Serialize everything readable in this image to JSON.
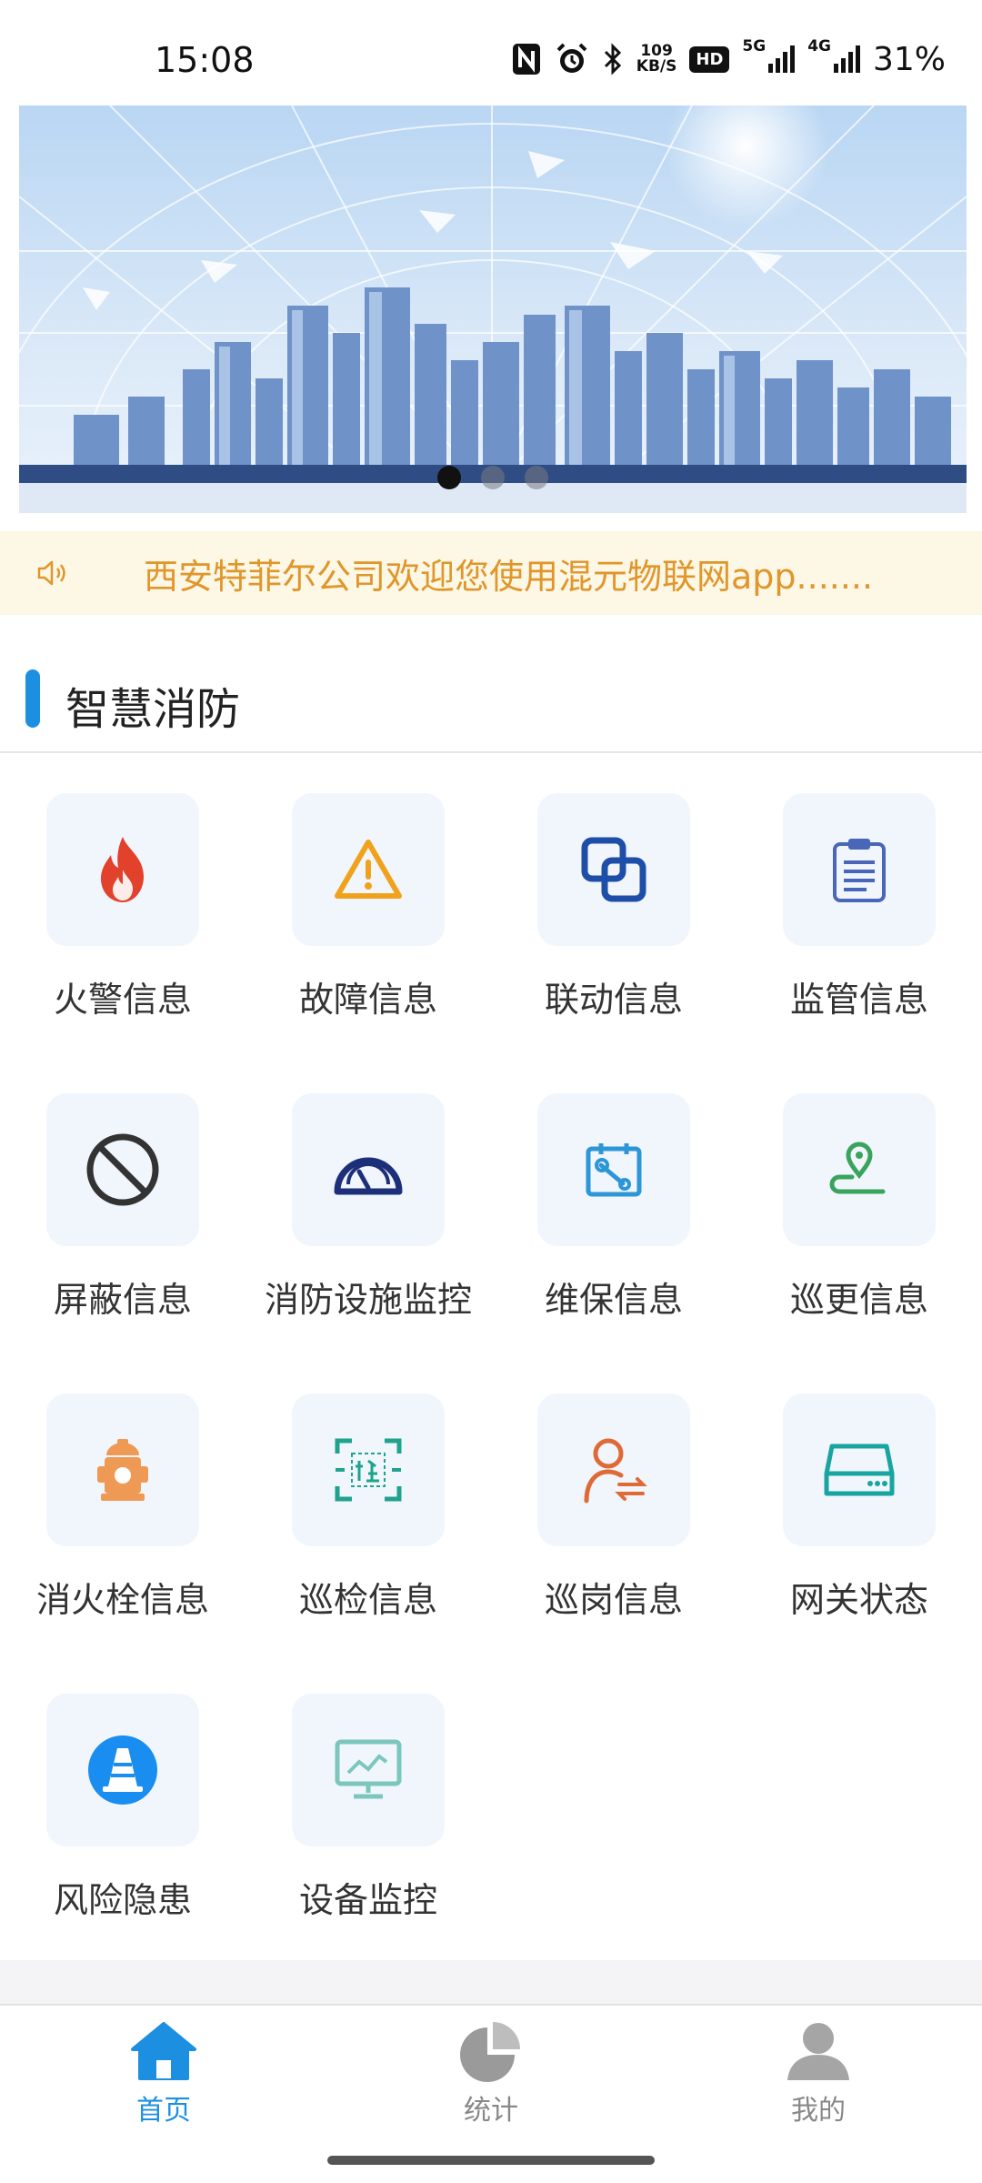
{
  "status_bar": {
    "time": "15:08",
    "icons": [
      "nfc-icon",
      "alarm-icon",
      "bluetooth-icon",
      "network-speed-icon",
      "hd-icon",
      "signal-5g-icon",
      "signal-4g-icon"
    ],
    "net_speed_value": "109",
    "net_speed_unit": "KB/S",
    "hd_label": "HD",
    "sig1_label": "5G",
    "sig2_label": "4G",
    "battery": "31%"
  },
  "banner": {
    "slide_count": 3,
    "active_slide": 1
  },
  "notice": {
    "icon": "speaker-icon",
    "text": "西安特菲尔公司欢迎您使用混元物联网app.......",
    "color": "#e0962a"
  },
  "section": {
    "title": "智慧消防",
    "accent": "#1d8fe0"
  },
  "menu": [
    {
      "label": "火警信息",
      "icon": "fire-icon"
    },
    {
      "label": "故障信息",
      "icon": "warning-icon"
    },
    {
      "label": "联动信息",
      "icon": "link-icon"
    },
    {
      "label": "监管信息",
      "icon": "clipboard-icon"
    },
    {
      "label": "屏蔽信息",
      "icon": "block-icon"
    },
    {
      "label": "消防设施监控",
      "icon": "gauge-icon"
    },
    {
      "label": "维保信息",
      "icon": "maintenance-icon"
    },
    {
      "label": "巡更信息",
      "icon": "location-route-icon"
    },
    {
      "label": "消火栓信息",
      "icon": "hydrant-icon"
    },
    {
      "label": "巡检信息",
      "icon": "inspect-scan-icon"
    },
    {
      "label": "巡岗信息",
      "icon": "person-switch-icon"
    },
    {
      "label": "网关状态",
      "icon": "gateway-icon"
    },
    {
      "label": "风险隐患",
      "icon": "traffic-cone-icon"
    },
    {
      "label": "设备监控",
      "icon": "monitor-chart-icon"
    }
  ],
  "tabbar": {
    "active_color": "#1d8fe0",
    "inactive_color": "#888888",
    "tabs": [
      {
        "label": "首页",
        "icon": "home-icon",
        "active": true
      },
      {
        "label": "统计",
        "icon": "pie-chart-icon",
        "active": false
      },
      {
        "label": "我的",
        "icon": "user-icon",
        "active": false
      }
    ]
  }
}
